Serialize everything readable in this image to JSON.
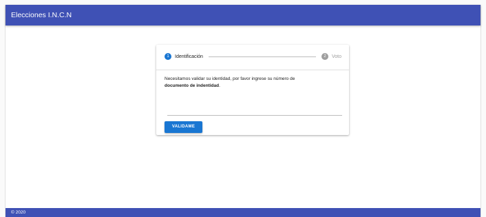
{
  "appbar": {
    "title": "Elecciones I.N.C.N"
  },
  "stepper": {
    "steps": [
      {
        "number": "1",
        "label": "Identificación",
        "active": true
      },
      {
        "number": "2",
        "label": "Voto",
        "active": false
      }
    ]
  },
  "form": {
    "instruction_text": "Necesitamos validar su identidad, por favor ingrese su número de",
    "instruction_bold": "documento de indentidad",
    "instruction_end": ".",
    "document_input": {
      "value": "",
      "placeholder": ""
    },
    "validate_label": "VALIDAME"
  },
  "footer": {
    "text": "© 2020"
  },
  "colors": {
    "primary": "#3f51b5",
    "accent": "#1976d2",
    "inactive": "#9e9e9e"
  }
}
